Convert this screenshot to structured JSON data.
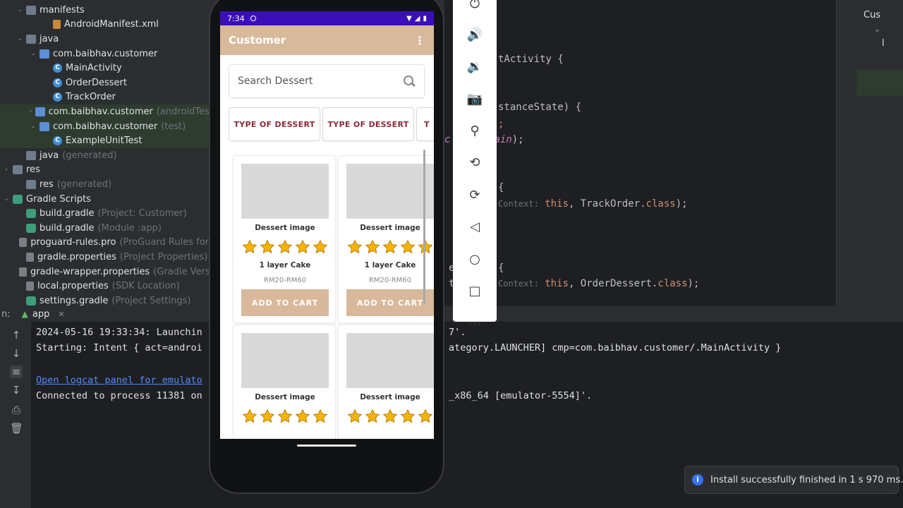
{
  "project_tree": [
    {
      "label": "manifests",
      "sub": "",
      "icon": "folder-icon",
      "arrow": "open"
    },
    {
      "label": "AndroidManifest.xml",
      "sub": "",
      "icon": "xml-file-icon",
      "arrow": ""
    },
    {
      "label": "java",
      "sub": "",
      "icon": "folder-icon",
      "arrow": "open"
    },
    {
      "label": "com.baibhav.customer",
      "sub": "",
      "icon": "package-icon",
      "arrow": "open"
    },
    {
      "label": "MainActivity",
      "sub": "",
      "icon": "class-icon",
      "arrow": ""
    },
    {
      "label": "OrderDessert",
      "sub": "",
      "icon": "class-icon",
      "arrow": ""
    },
    {
      "label": "TrackOrder",
      "sub": "",
      "icon": "class-icon",
      "arrow": ""
    },
    {
      "label": "com.baibhav.customer",
      "sub": "(androidTest)",
      "icon": "package-icon",
      "arrow": "closed"
    },
    {
      "label": "com.baibhav.customer",
      "sub": "(test)",
      "icon": "package-icon",
      "arrow": "open"
    },
    {
      "label": "ExampleUnitTest",
      "sub": "",
      "icon": "class-icon",
      "arrow": ""
    },
    {
      "label": "java",
      "sub": "(generated)",
      "icon": "folder-icon",
      "arrow": ""
    },
    {
      "label": "res",
      "sub": "",
      "icon": "folder-icon",
      "arrow": "closed"
    },
    {
      "label": "res",
      "sub": "(generated)",
      "icon": "folder-icon",
      "arrow": ""
    },
    {
      "label": "Gradle Scripts",
      "sub": "",
      "icon": "gradle-icon",
      "arrow": "open"
    },
    {
      "label": "build.gradle",
      "sub": "(Project: Customer)",
      "icon": "gradle-icon",
      "arrow": ""
    },
    {
      "label": "build.gradle",
      "sub": "(Module :app)",
      "icon": "gradle-icon",
      "arrow": ""
    },
    {
      "label": "proguard-rules.pro",
      "sub": "(ProGuard Rules for",
      "icon": "properties-icon",
      "arrow": ""
    },
    {
      "label": "gradle.properties",
      "sub": "(Project Properties)",
      "icon": "properties-icon",
      "arrow": ""
    },
    {
      "label": "gradle-wrapper.properties",
      "sub": "(Gradle Versi",
      "icon": "properties-icon",
      "arrow": ""
    },
    {
      "label": "local.properties",
      "sub": "(SDK Location)",
      "icon": "properties-icon",
      "arrow": ""
    },
    {
      "label": "settings.gradle",
      "sub": "(Project Settings)",
      "icon": "gradle-icon",
      "arrow": ""
    }
  ],
  "run_panel": {
    "prefix": "n:",
    "tab": "app"
  },
  "console": {
    "left_lines": [
      "2024-05-16 19:33:34: Launchin",
      "Starting: Intent { act=androi",
      "Open logcat panel for emulato",
      "Connected to process 11381 on"
    ],
    "right_lines": [
      "7'.",
      "ategory.LAUNCHER] cmp=com.baibhav.customer/.MainActivity }",
      "_x86_64 [emulator-5554]'."
    ]
  },
  "editor": {
    "l1": "tActivity {",
    "l2": "stanceState) {",
    "l3a": "c",
    "l3b": "ain",
    "l3c": ");",
    "l4": "{",
    "l5_hint": "Context:",
    "l5_this": "this",
    "l5_rest": ", TrackOrder.",
    "l5_class": "class",
    "l5_end": ");",
    "l6": "{",
    "l7_hint": "Context:",
    "l7_this": "this",
    "l7_rest": ", OrderDessert.",
    "l7_class": "class",
    "l7_end": ");",
    "l8": "e",
    "l9": "t",
    "semi": ";"
  },
  "structure_panel": {
    "item1": "Cus",
    "item2": "⌄",
    "item3": "l"
  },
  "phone": {
    "status_time": "7:34",
    "app_title": "Customer",
    "overflow_menu": "⋮",
    "search_placeholder": "Search Dessert",
    "chips": [
      "TYPE OF DESSERT",
      "TYPE OF DESSERT",
      "T"
    ],
    "cards": [
      {
        "image_label": "Dessert image",
        "name": "1 layer Cake",
        "price": "RM20-RM60",
        "button": "ADD TO CART",
        "rating_stars": 5
      },
      {
        "image_label": "Dessert image",
        "name": "1 layer Cake",
        "price": "RM20-RM60",
        "button": "ADD TO CART",
        "rating_stars": 5
      },
      {
        "image_label": "Dessert image",
        "rating_stars": 5
      },
      {
        "image_label": "Dessert image",
        "rating_stars": 5
      }
    ],
    "colors": {
      "status_bar": "#3b0fb8",
      "app_bar": "#d8b99b",
      "chip_text": "#8b2a3a",
      "star": "#f4b400"
    }
  },
  "emulator_toolbar": [
    "power-icon",
    "volume-up-icon",
    "volume-down-icon",
    "camera-icon",
    "zoom-icon",
    "rotate-left-icon",
    "rotate-right-icon",
    "back-icon",
    "home-icon",
    "overview-icon",
    "more-icon"
  ],
  "notification": {
    "text": "Install successfully finished in 1 s 970 ms."
  }
}
